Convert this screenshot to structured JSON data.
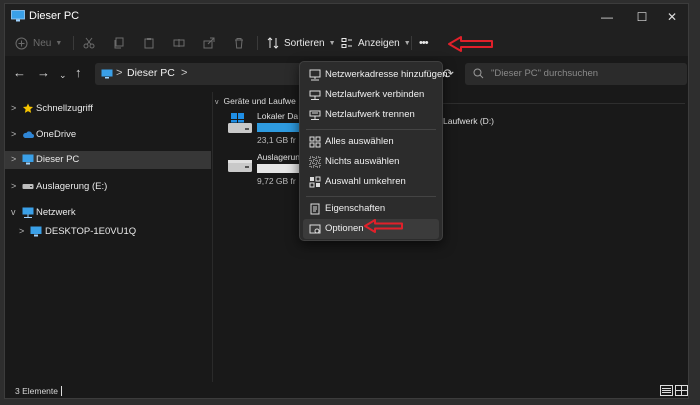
{
  "window": {
    "title": "Dieser PC"
  },
  "window_controls": {
    "minimize": "—",
    "maximize": "☐",
    "close": "✕"
  },
  "toolbar": {
    "new_label": "Neu",
    "sort_label": "Sortieren",
    "view_label": "Anzeigen",
    "more_label": "•••"
  },
  "nav": {
    "back": "←",
    "forward": "→",
    "recent": "⌄",
    "up": "↑",
    "address_segment": "Dieser PC",
    "address_sep_1": ">",
    "address_sep_2": ">",
    "refresh": "⟳",
    "search_placeholder": "\"Dieser PC\" durchsuchen"
  },
  "sidebar": {
    "items": [
      {
        "label": "Schnellzugriff",
        "icon": "star-icon",
        "expander": ">"
      },
      {
        "label": "OneDrive",
        "icon": "cloud-icon",
        "expander": ">"
      },
      {
        "label": "Dieser PC",
        "icon": "monitor-icon",
        "expander": ">"
      },
      {
        "label": "Auslagerung (E:)",
        "icon": "drive-icon",
        "expander": ">"
      },
      {
        "label": "Netzwerk",
        "icon": "network-icon",
        "expander": "v"
      },
      {
        "label": "DESKTOP-1E0VU1Q",
        "icon": "monitor-icon",
        "expander": ">"
      }
    ]
  },
  "content": {
    "section_title": "Geräte und Laufwe",
    "section_chevron": "v",
    "drives": [
      {
        "name": "Lokaler Da",
        "free": "23,1 GB fr",
        "used_fraction": 0.55,
        "icon": "windows-drive-icon"
      },
      {
        "name": "Auslagerun",
        "free": "9,72 GB fr",
        "used_fraction": 0.0,
        "icon": "drive-icon"
      }
    ],
    "third_drive_name": "Laufwerk (D:)"
  },
  "context_menu": {
    "items": [
      {
        "label": "Netzwerkadresse hinzufügen",
        "icon": "network-location-icon"
      },
      {
        "label": "Netzlaufwerk verbinden",
        "icon": "map-drive-icon"
      },
      {
        "label": "Netzlaufwerk trennen",
        "icon": "disconnect-drive-icon"
      },
      {
        "label": "Alles auswählen",
        "icon": "select-all-icon"
      },
      {
        "label": "Nichts auswählen",
        "icon": "select-none-icon"
      },
      {
        "label": "Auswahl umkehren",
        "icon": "invert-selection-icon"
      },
      {
        "label": "Eigenschaften",
        "icon": "properties-icon"
      },
      {
        "label": "Optionen",
        "icon": "options-icon"
      }
    ]
  },
  "status": {
    "item_count": "3 Elemente"
  },
  "colors": {
    "accent": "#2e9be0",
    "annotation_arrow": "#e0202a",
    "background": "#191919"
  }
}
